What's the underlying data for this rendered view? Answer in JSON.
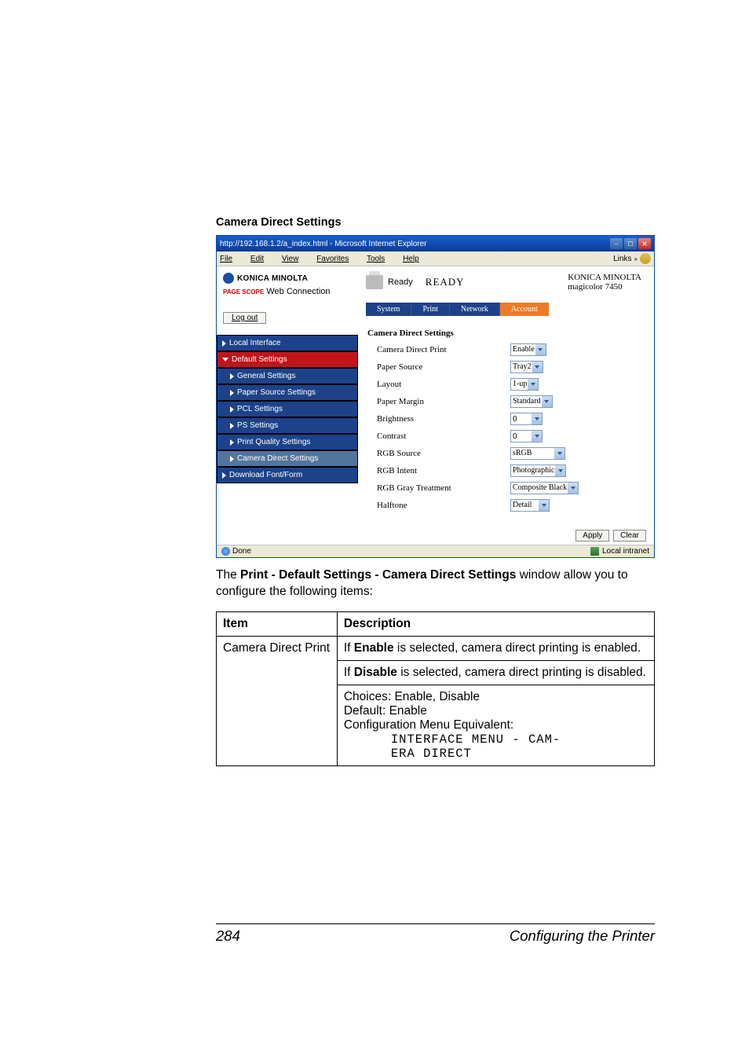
{
  "heading": "Camera Direct Settings",
  "window": {
    "title": "http://192.168.1.2/a_index.html - Microsoft Internet Explorer",
    "menubar": {
      "file": "File",
      "edit": "Edit",
      "view": "View",
      "favorites": "Favorites",
      "tools": "Tools",
      "help": "Help",
      "links": "Links"
    },
    "brand": {
      "konica": "KONICA MINOLTA",
      "pagescope_icon": "PAGE SCOPE",
      "web_conn": "Web Connection"
    },
    "logout": "Log out",
    "status": {
      "ready_small": "Ready",
      "ready_big": "READY",
      "device_brand": "KONICA MINOLTA",
      "device_model": "magicolor 7450"
    },
    "tabs": {
      "system": "System",
      "print": "Print",
      "network": "Network",
      "account": "Account"
    },
    "nav": {
      "local_interface": "Local Interface",
      "default_settings": "Default Settings",
      "general": "General Settings",
      "paper_source": "Paper Source Settings",
      "pcl": "PCL Settings",
      "ps": "PS Settings",
      "print_quality": "Print Quality Settings",
      "camera_direct": "Camera Direct Settings",
      "download_font": "Download Font/Form"
    },
    "panel_title": "Camera Direct Settings",
    "rows": {
      "camera_direct_print": {
        "label": "Camera Direct Print",
        "value": "Enable"
      },
      "paper_source": {
        "label": "Paper Source",
        "value": "Tray2"
      },
      "layout": {
        "label": "Layout",
        "value": "1-up"
      },
      "paper_margin": {
        "label": "Paper Margin",
        "value": "Standard"
      },
      "brightness": {
        "label": "Brightness",
        "value": "0"
      },
      "contrast": {
        "label": "Contrast",
        "value": "0"
      },
      "rgb_source": {
        "label": "RGB Source",
        "value": "sRGB"
      },
      "rgb_intent": {
        "label": "RGB Intent",
        "value": "Photographic"
      },
      "rgb_gray": {
        "label": "RGB Gray Treatment",
        "value": "Composite Black"
      },
      "halftone": {
        "label": "Halftone",
        "value": "Detail"
      }
    },
    "buttons": {
      "apply": "Apply",
      "clear": "Clear"
    },
    "statusbar": {
      "done": "Done",
      "zone": "Local intranet"
    }
  },
  "caption": {
    "pre": "The ",
    "bold": "Print - Default Settings - Camera Direct Settings",
    "post": " window allow you to configure the following items:"
  },
  "table": {
    "head_item": "Item",
    "head_desc": "Description",
    "item1": "Camera Direct Print",
    "p1a": "If ",
    "p1b": "Enable",
    "p1c": " is selected, camera direct printing is enabled.",
    "p2a": "If ",
    "p2b": "Disable",
    "p2c": " is selected, camera direct printing is disabled.",
    "choices": "Choices: Enable, Disable",
    "default": "Default:  Enable",
    "config": "Configuration Menu Equivalent:",
    "mono1": "INTERFACE MENU - CAM-",
    "mono2": "ERA DIRECT"
  },
  "footer": {
    "page": "284",
    "text": "Configuring the Printer"
  }
}
